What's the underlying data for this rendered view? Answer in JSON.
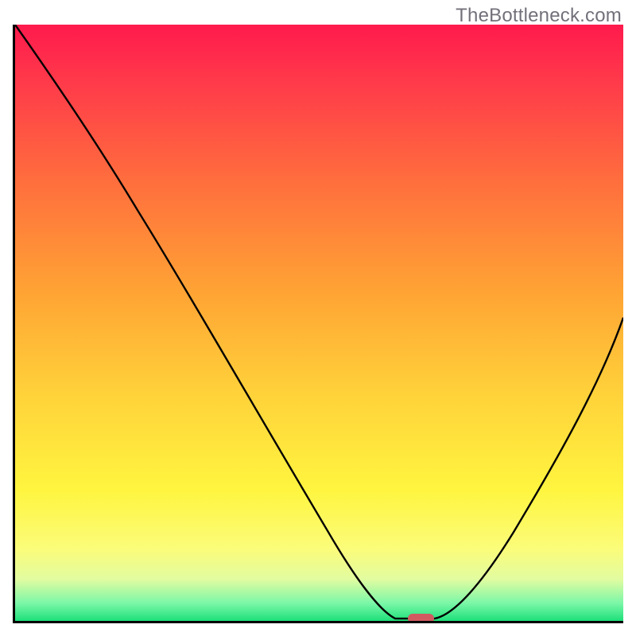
{
  "watermark": "TheBottleneck.com",
  "chart_data": {
    "type": "line",
    "title": "",
    "xlabel": "",
    "ylabel": "",
    "x": [
      0.0,
      0.05,
      0.1,
      0.15,
      0.2,
      0.25,
      0.3,
      0.35,
      0.4,
      0.45,
      0.5,
      0.55,
      0.6,
      0.62,
      0.64,
      0.66,
      0.68,
      0.7,
      0.75,
      0.8,
      0.85,
      0.9,
      0.95,
      1.0
    ],
    "y": [
      1.0,
      0.92,
      0.83,
      0.74,
      0.67,
      0.6,
      0.52,
      0.44,
      0.36,
      0.28,
      0.2,
      0.12,
      0.04,
      0.01,
      0.0,
      0.0,
      0.0,
      0.01,
      0.07,
      0.16,
      0.25,
      0.34,
      0.43,
      0.51
    ],
    "xlim": [
      0,
      1
    ],
    "ylim": [
      0,
      1
    ],
    "marker": {
      "x": 0.664,
      "y": 0.0
    },
    "colors": {
      "line": "#000000",
      "marker": "#d15a60",
      "gradient_top": "#ff1a4d",
      "gradient_bottom": "#1ee07a"
    }
  }
}
